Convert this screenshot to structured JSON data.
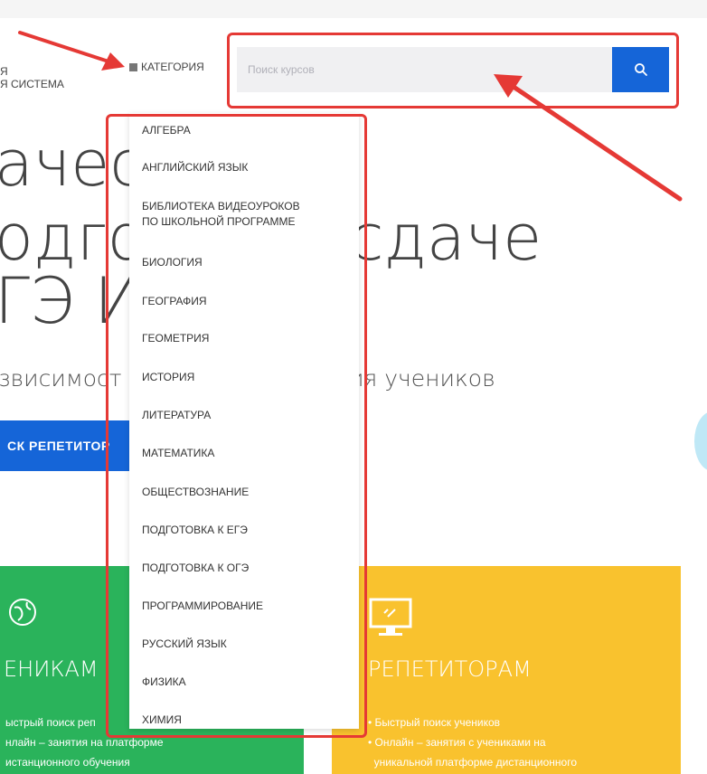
{
  "header": {
    "logo_line1": "Я",
    "logo_line2": "Я СИСТЕМА",
    "category_label": "КАТЕГОРИЯ"
  },
  "search": {
    "placeholder": "Поиск курсов",
    "button_icon": "search-icon"
  },
  "hero": {
    "line1": "ачест",
    "line2": "одго",
    "line2b": "сдаче",
    "line3": "ГЭ И",
    "subtitle_left": "звисимост",
    "subtitle_right": "ия учеников",
    "cta_label": "СК РЕПЕТИТОР"
  },
  "dropdown": {
    "items": [
      "АЛГЕБРА",
      "АНГЛИЙСКИЙ ЯЗЫК",
      "БИБЛИОТЕКА ВИДЕОУРОКОВ",
      "ПО ШКОЛЬНОЙ ПРОГРАММЕ",
      "БИОЛОГИЯ",
      "ГЕОГРАФИЯ",
      "ГЕОМЕТРИЯ",
      "ИСТОРИЯ",
      "ЛИТЕРАТУРА",
      "МАТЕМАТИКА",
      "ОБЩЕСТВОЗНАНИЕ",
      "ПОДГОТОВКА К ЕГЭ",
      "ПОДГОТОВКА К ОГЭ",
      "ПРОГРАММИРОВАНИЕ",
      "РУССКИЙ ЯЗЫК",
      "ФИЗИКА",
      "ХИМИЯ"
    ]
  },
  "cards": {
    "students": {
      "title": "ЕНИКАМ",
      "items": [
        "ыстрый поиск реп",
        "нлайн – занятия на платформе",
        "истанционного обучения"
      ]
    },
    "tutors": {
      "title": "РЕПЕТИТОРАМ",
      "items": [
        "Быстрый поиск учеников",
        "Онлайн – занятия с учениками на",
        "уникальной платформе дистанционного"
      ]
    }
  },
  "colors": {
    "accent_blue": "#1565d8",
    "highlight_red": "#e53935",
    "green_card": "#2ab35b",
    "yellow_card": "#f9c22e"
  }
}
